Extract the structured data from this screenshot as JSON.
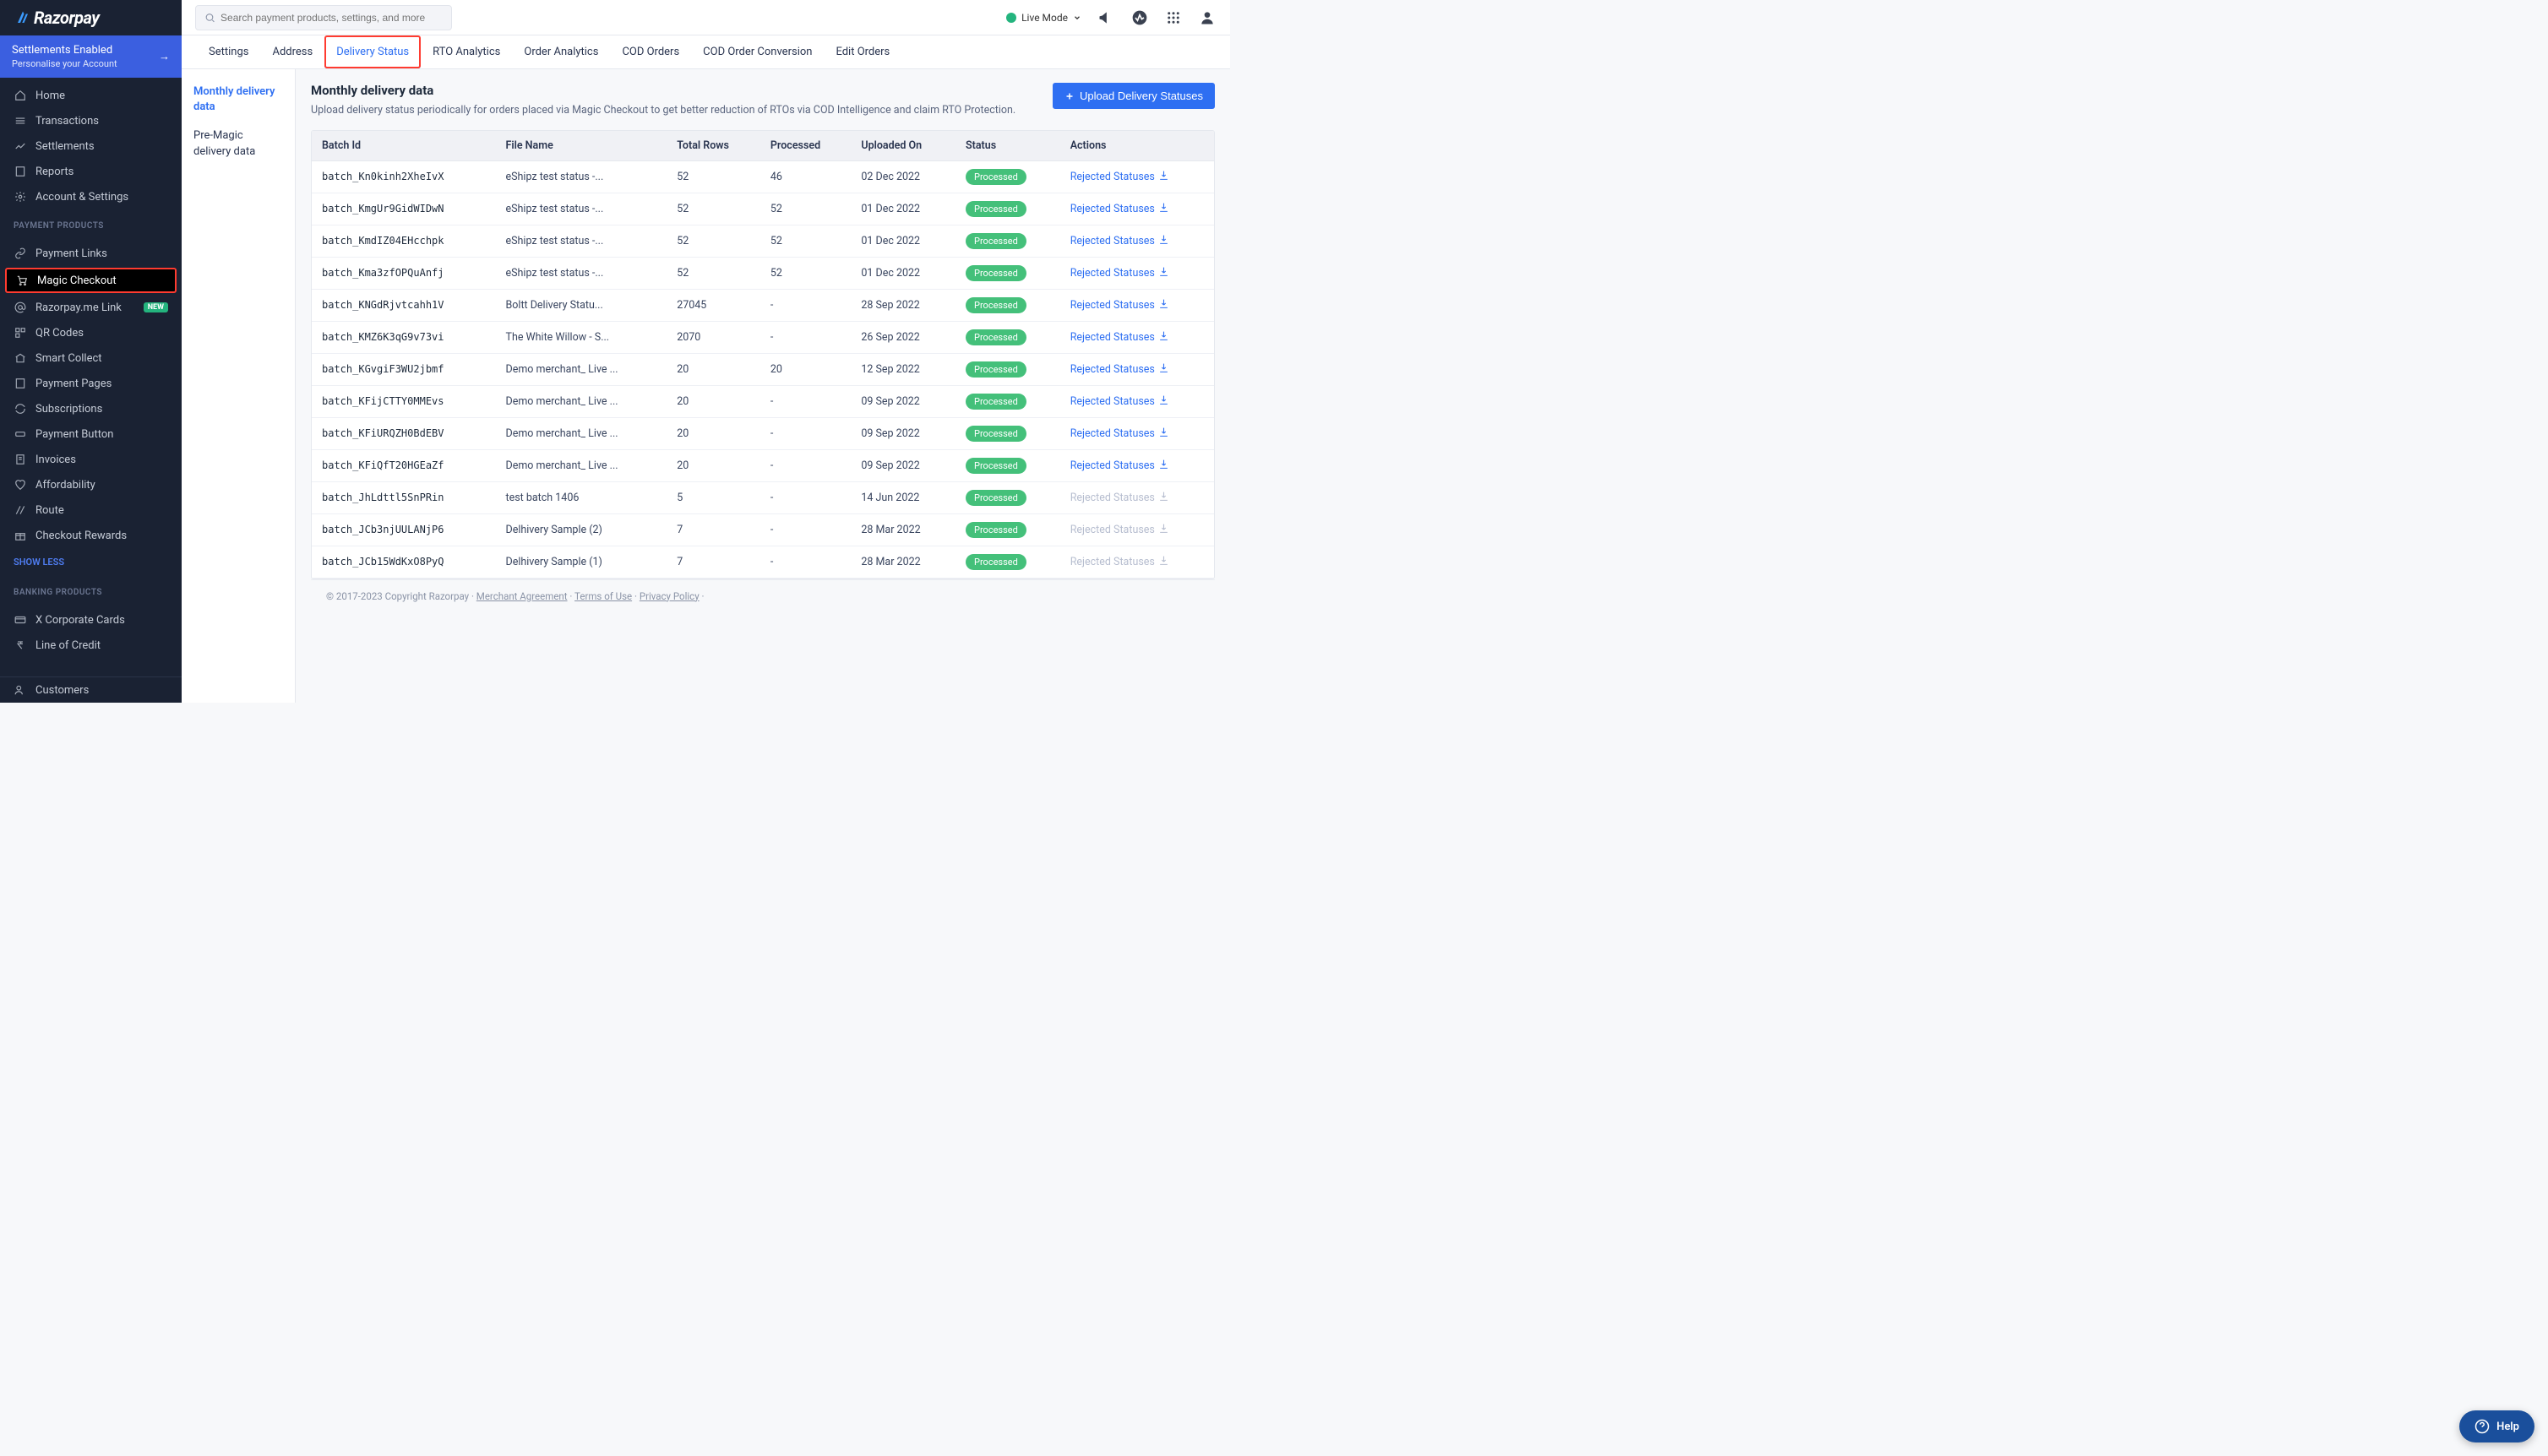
{
  "brand": {
    "name": "Razorpay"
  },
  "sidebar": {
    "settlements_enabled": "Settlements Enabled",
    "personalise": "Personalise your Account",
    "nav_primary": [
      {
        "label": "Home"
      },
      {
        "label": "Transactions"
      },
      {
        "label": "Settlements"
      },
      {
        "label": "Reports"
      },
      {
        "label": "Account & Settings"
      }
    ],
    "section_products": "PAYMENT PRODUCTS",
    "nav_products": [
      {
        "label": "Payment Links"
      },
      {
        "label": "Magic Checkout",
        "active": true
      },
      {
        "label": "Razorpay.me Link",
        "badge": "NEW"
      },
      {
        "label": "QR Codes"
      },
      {
        "label": "Smart Collect"
      },
      {
        "label": "Payment Pages"
      },
      {
        "label": "Subscriptions"
      },
      {
        "label": "Payment Button"
      },
      {
        "label": "Invoices"
      },
      {
        "label": "Affordability"
      },
      {
        "label": "Route"
      },
      {
        "label": "Checkout Rewards"
      }
    ],
    "show_less": "SHOW LESS",
    "section_banking": "BANKING PRODUCTS",
    "nav_banking": [
      {
        "label": "X Corporate Cards"
      },
      {
        "label": "Line of Credit"
      }
    ],
    "customers": "Customers"
  },
  "topbar": {
    "search_placeholder": "Search payment products, settings, and more",
    "live_mode": "Live Mode"
  },
  "tabs": [
    {
      "label": "Settings"
    },
    {
      "label": "Address"
    },
    {
      "label": "Delivery Status",
      "active": true,
      "highlighted": true
    },
    {
      "label": "RTO Analytics"
    },
    {
      "label": "Order Analytics"
    },
    {
      "label": "COD Orders"
    },
    {
      "label": "COD Order Conversion"
    },
    {
      "label": "Edit Orders"
    }
  ],
  "subnav": [
    {
      "label": "Monthly delivery data",
      "active": true
    },
    {
      "label": "Pre-Magic delivery data"
    }
  ],
  "page": {
    "title": "Monthly delivery data",
    "subtitle": "Upload delivery status periodically for orders placed via Magic Checkout to get better reduction of RTOs via COD Intelligence and claim RTO Protection.",
    "upload_btn": "Upload Delivery Statuses"
  },
  "table": {
    "columns": [
      "Batch Id",
      "File Name",
      "Total Rows",
      "Processed",
      "Uploaded On",
      "Status",
      "Actions"
    ],
    "status_label": "Processed",
    "action_label": "Rejected Statuses",
    "rows": [
      {
        "batch": "batch_Kn0kinh2XheIvX",
        "file": "eShipz test status -...",
        "total": "52",
        "processed": "46",
        "uploaded": "02 Dec 2022",
        "status": "Processed",
        "action_enabled": true
      },
      {
        "batch": "batch_KmgUr9GidWIDwN",
        "file": "eShipz test status -...",
        "total": "52",
        "processed": "52",
        "uploaded": "01 Dec 2022",
        "status": "Processed",
        "action_enabled": true
      },
      {
        "batch": "batch_KmdIZ04EHcchpk",
        "file": "eShipz test status -...",
        "total": "52",
        "processed": "52",
        "uploaded": "01 Dec 2022",
        "status": "Processed",
        "action_enabled": true
      },
      {
        "batch": "batch_Kma3zfOPQuAnfj",
        "file": "eShipz test status -...",
        "total": "52",
        "processed": "52",
        "uploaded": "01 Dec 2022",
        "status": "Processed",
        "action_enabled": true
      },
      {
        "batch": "batch_KNGdRjvtcahh1V",
        "file": "Boltt Delivery Statu...",
        "total": "27045",
        "processed": "-",
        "uploaded": "28 Sep 2022",
        "status": "Processed",
        "action_enabled": true
      },
      {
        "batch": "batch_KMZ6K3qG9v73vi",
        "file": "The White Willow - S...",
        "total": "2070",
        "processed": "-",
        "uploaded": "26 Sep 2022",
        "status": "Processed",
        "action_enabled": true
      },
      {
        "batch": "batch_KGvgiF3WU2jbmf",
        "file": "Demo merchant_ Live ...",
        "total": "20",
        "processed": "20",
        "uploaded": "12 Sep 2022",
        "status": "Processed",
        "action_enabled": true
      },
      {
        "batch": "batch_KFijCTTY0MMEvs",
        "file": "Demo merchant_ Live ...",
        "total": "20",
        "processed": "-",
        "uploaded": "09 Sep 2022",
        "status": "Processed",
        "action_enabled": true
      },
      {
        "batch": "batch_KFiURQZH0BdEBV",
        "file": "Demo merchant_ Live ...",
        "total": "20",
        "processed": "-",
        "uploaded": "09 Sep 2022",
        "status": "Processed",
        "action_enabled": true
      },
      {
        "batch": "batch_KFiQfT20HGEaZf",
        "file": "Demo merchant_ Live ...",
        "total": "20",
        "processed": "-",
        "uploaded": "09 Sep 2022",
        "status": "Processed",
        "action_enabled": true
      },
      {
        "batch": "batch_JhLdttl5SnPRin",
        "file": "test batch 1406",
        "total": "5",
        "processed": "-",
        "uploaded": "14 Jun 2022",
        "status": "Processed",
        "action_enabled": false
      },
      {
        "batch": "batch_JCb3njUULANjP6",
        "file": "Delhivery Sample (2)",
        "total": "7",
        "processed": "-",
        "uploaded": "28 Mar 2022",
        "status": "Processed",
        "action_enabled": false
      },
      {
        "batch": "batch_JCb15WdKxO8PyQ",
        "file": "Delhivery Sample (1)",
        "total": "7",
        "processed": "-",
        "uploaded": "28 Mar 2022",
        "status": "Processed",
        "action_enabled": false
      }
    ]
  },
  "footer": {
    "copyright": "© 2017-2023 Copyright Razorpay · ",
    "links": [
      "Merchant Agreement",
      "Terms of Use",
      "Privacy Policy"
    ]
  },
  "help": {
    "label": "Help"
  }
}
